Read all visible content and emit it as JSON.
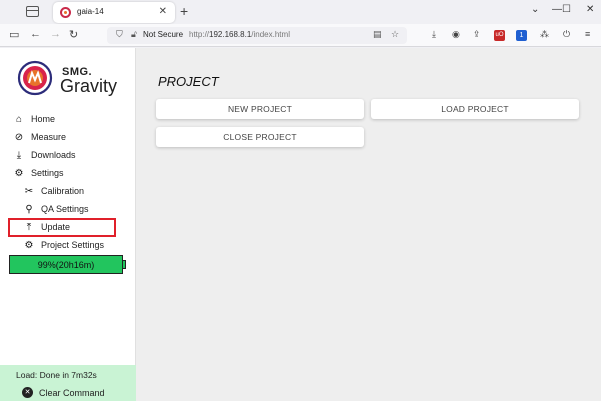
{
  "browser": {
    "tab_title": "gaia-14",
    "not_secure": "Not Secure",
    "url_prefix": "http://",
    "url_host": "192.168.8.1",
    "url_path": "/index.html"
  },
  "logo": {
    "brand_top": "SMG.",
    "brand_bottom": "Gravity"
  },
  "sidebar": {
    "items": [
      {
        "label": "Home",
        "icon": "home-icon"
      },
      {
        "label": "Measure",
        "icon": "measure-icon"
      },
      {
        "label": "Downloads",
        "icon": "download-icon"
      },
      {
        "label": "Settings",
        "icon": "gear-icon"
      },
      {
        "label": "Calibration",
        "icon": "tools-icon"
      },
      {
        "label": "QA Settings",
        "icon": "search-icon"
      },
      {
        "label": "Update",
        "icon": "upload-icon"
      },
      {
        "label": "Project Settings",
        "icon": "gear-icon"
      }
    ],
    "battery_text": "99%(20h16m)",
    "battery_level_percent": 99,
    "load_status": "Load: Done in 7m32s",
    "clear_command": "Clear Command"
  },
  "main": {
    "title": "PROJECT",
    "buttons": {
      "new_project": "NEW PROJECT",
      "load_project": "LOAD PROJECT",
      "close_project": "CLOSE PROJECT"
    }
  },
  "colors": {
    "battery": "#22c55e",
    "highlight": "#e0202a",
    "status_panel": "#c9f3d4"
  }
}
